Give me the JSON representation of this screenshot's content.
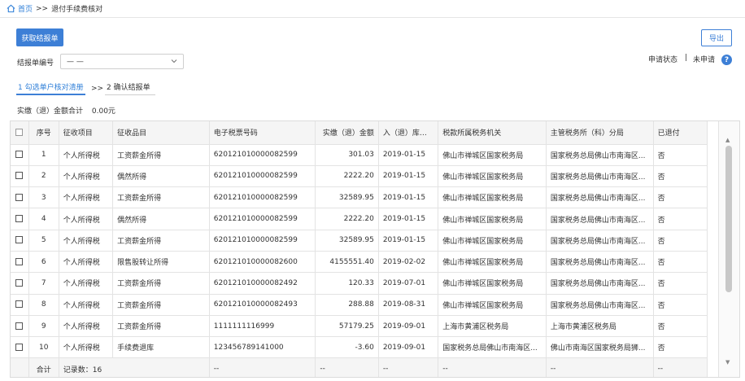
{
  "breadcrumb": {
    "home": "首页",
    "sep": ">>",
    "current": "退付手续费核对"
  },
  "toolbar": {
    "fetch_label": "获取结报单",
    "export_label": "导出"
  },
  "form": {
    "label": "结报单编号",
    "value": "— —"
  },
  "status": {
    "label": "申请状态",
    "divider": "|",
    "value": "未申请"
  },
  "steps": {
    "step1": "1 勾选单户核对清册",
    "arrow": ">>",
    "step2": "2 确认结报单"
  },
  "summary": {
    "label": "实缴（退）金额合计",
    "amount": "0.00元"
  },
  "table": {
    "headers": {
      "seq": "序号",
      "item": "征收项目",
      "subitem": "征收品目",
      "ticket": "电子税票号码",
      "amount": "实缴（退）金额",
      "date": "入（退）库日期",
      "org": "税款所属税务机关",
      "manager": "主管税务所（科）分局",
      "refunded": "已退付"
    },
    "rows": [
      {
        "seq": "1",
        "item": "个人所得税",
        "subitem": "工资薪金所得",
        "ticket": "620121010000082599",
        "amount": "301.03",
        "date": "2019-01-15",
        "org": "佛山市禅城区国家税务局",
        "manager": "国家税务总局佛山市南海区...",
        "refunded": "否"
      },
      {
        "seq": "2",
        "item": "个人所得税",
        "subitem": "偶然所得",
        "ticket": "620121010000082599",
        "amount": "2222.20",
        "date": "2019-01-15",
        "org": "佛山市禅城区国家税务局",
        "manager": "国家税务总局佛山市南海区...",
        "refunded": "否"
      },
      {
        "seq": "3",
        "item": "个人所得税",
        "subitem": "工资薪金所得",
        "ticket": "620121010000082599",
        "amount": "32589.95",
        "date": "2019-01-15",
        "org": "佛山市禅城区国家税务局",
        "manager": "国家税务总局佛山市南海区...",
        "refunded": "否"
      },
      {
        "seq": "4",
        "item": "个人所得税",
        "subitem": "偶然所得",
        "ticket": "620121010000082599",
        "amount": "2222.20",
        "date": "2019-01-15",
        "org": "佛山市禅城区国家税务局",
        "manager": "国家税务总局佛山市南海区...",
        "refunded": "否"
      },
      {
        "seq": "5",
        "item": "个人所得税",
        "subitem": "工资薪金所得",
        "ticket": "620121010000082599",
        "amount": "32589.95",
        "date": "2019-01-15",
        "org": "佛山市禅城区国家税务局",
        "manager": "国家税务总局佛山市南海区...",
        "refunded": "否"
      },
      {
        "seq": "6",
        "item": "个人所得税",
        "subitem": "限售股转让所得",
        "ticket": "620121010000082600",
        "amount": "4155551.40",
        "date": "2019-02-02",
        "org": "佛山市禅城区国家税务局",
        "manager": "国家税务总局佛山市南海区...",
        "refunded": "否"
      },
      {
        "seq": "7",
        "item": "个人所得税",
        "subitem": "工资薪金所得",
        "ticket": "620121010000082492",
        "amount": "120.33",
        "date": "2019-07-01",
        "org": "佛山市禅城区国家税务局",
        "manager": "国家税务总局佛山市南海区...",
        "refunded": "否"
      },
      {
        "seq": "8",
        "item": "个人所得税",
        "subitem": "工资薪金所得",
        "ticket": "620121010000082493",
        "amount": "288.88",
        "date": "2019-08-31",
        "org": "佛山市禅城区国家税务局",
        "manager": "国家税务总局佛山市南海区...",
        "refunded": "否"
      },
      {
        "seq": "9",
        "item": "个人所得税",
        "subitem": "工资薪金所得",
        "ticket": "1111111116999",
        "amount": "57179.25",
        "date": "2019-09-01",
        "org": "上海市黄浦区税务局",
        "manager": "上海市黄浦区税务局",
        "refunded": "否"
      },
      {
        "seq": "10",
        "item": "个人所得税",
        "subitem": "手续费退库",
        "ticket": "123456789141000",
        "amount": "-3.60",
        "date": "2019-09-01",
        "org": "国家税务总局佛山市南海区...",
        "manager": "佛山市南海区国家税务局狮...",
        "refunded": "否"
      }
    ],
    "footer": {
      "total_label": "合计",
      "count_label": "记录数：16",
      "dash": "--"
    }
  },
  "colors": {
    "accent": "#3d7fd6",
    "link": "#2f7fd8"
  }
}
